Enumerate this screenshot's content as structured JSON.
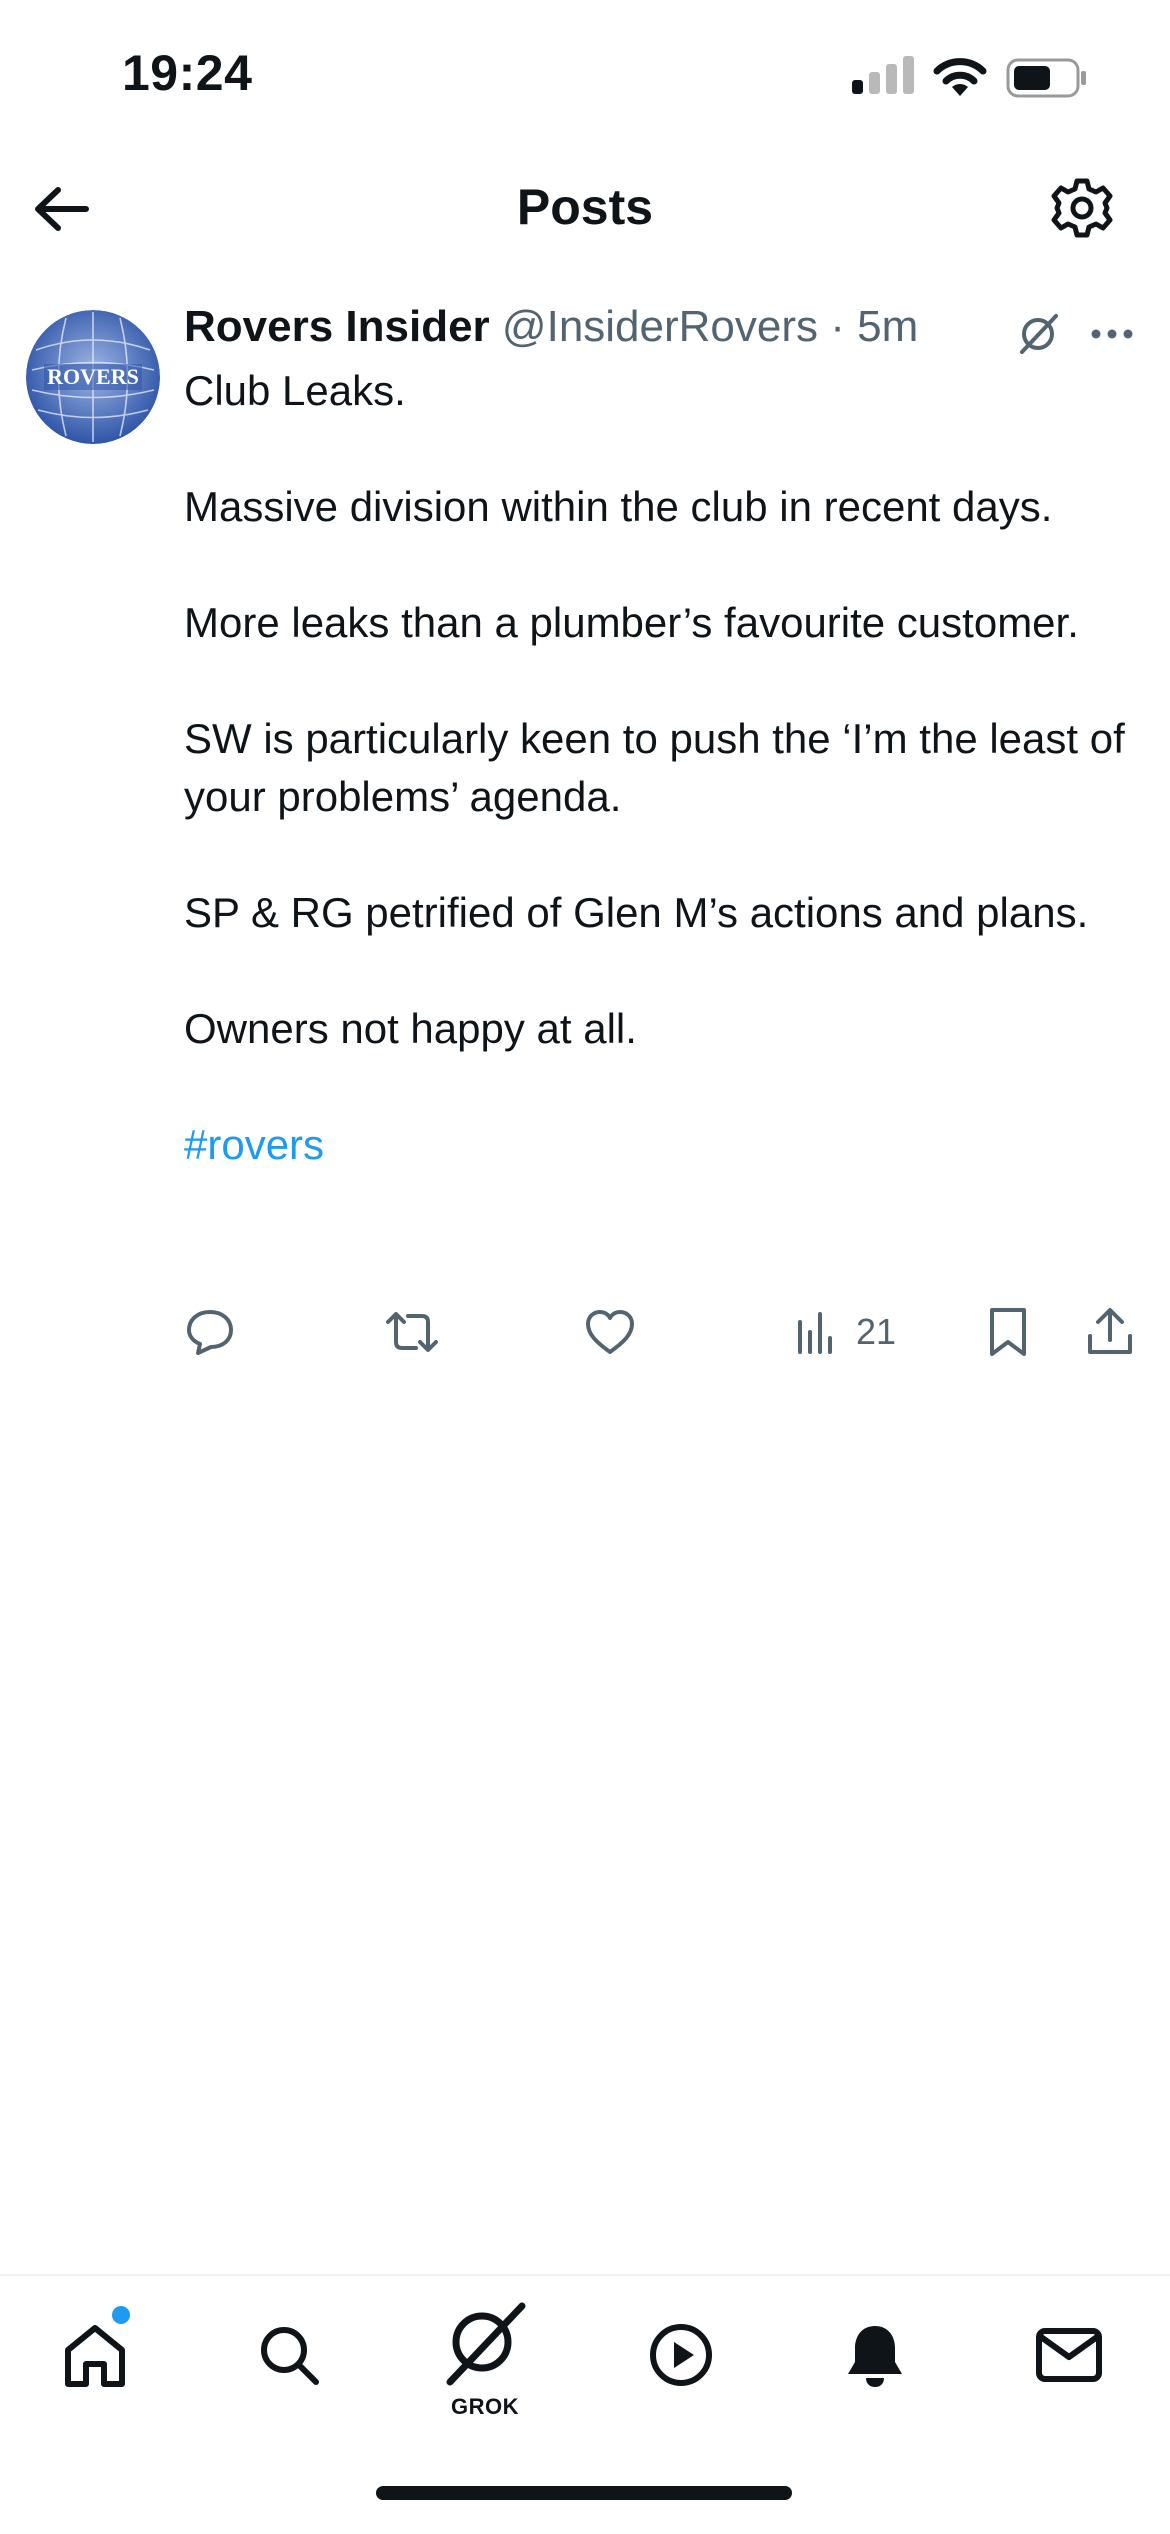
{
  "status_bar": {
    "time": "19:24"
  },
  "header": {
    "title": "Posts"
  },
  "post": {
    "author_name": "Rovers Insider",
    "author_handle": "@InsiderRovers",
    "separator": "·",
    "time_ago": "5m",
    "avatar_text": "ROVERS",
    "body": [
      "Club Leaks.",
      "Massive division within the club in recent days.",
      "More leaks than a plumber’s favourite customer.",
      "SW is particularly keen to push the ‘I’m the least of your problems’ agenda.",
      "SP & RG petrified of Glen M’s actions and plans.",
      "Owners not happy at all."
    ],
    "hashtag": "#rovers",
    "view_count": "21"
  },
  "tab_bar": {
    "grok_label": "GROK"
  },
  "colors": {
    "accent": "#1d9bf0",
    "text": "#0f1419",
    "secondary": "#536471"
  }
}
